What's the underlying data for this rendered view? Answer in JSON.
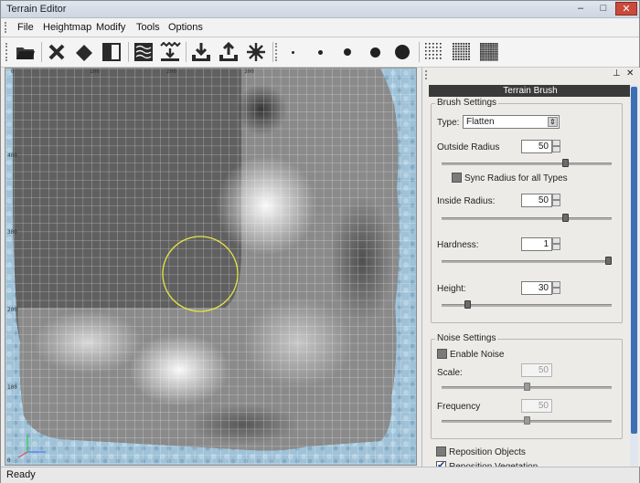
{
  "window": {
    "title": "Terrain Editor",
    "min": "–",
    "max": "□",
    "close": "✕"
  },
  "menu": [
    {
      "label": "File"
    },
    {
      "label": "Heightmap"
    },
    {
      "label": "Modify"
    },
    {
      "label": "Tools"
    },
    {
      "label": "Options"
    }
  ],
  "toolbar": {
    "icons": [
      "open-folder-icon",
      "clear-x-icon",
      "eraser-icon",
      "split-panel-icon",
      "terrain-texture-icon",
      "import-heightmap-icon",
      "download-icon",
      "export-icon",
      "sun-icon"
    ],
    "brush_sizes": [
      "tiny",
      "small",
      "medium",
      "large",
      "xlarge"
    ],
    "density": [
      "sparse",
      "medium",
      "dense"
    ]
  },
  "viewport": {
    "ruler_x": [
      "0",
      "100",
      "200",
      "300"
    ],
    "ruler_y": [
      "400",
      "300",
      "200",
      "100",
      "0"
    ],
    "colors": {
      "water": "#9bbcd3",
      "grid": "#ffffff"
    }
  },
  "panel": {
    "pin": "⊥",
    "close": "✕",
    "header": "Terrain Brush",
    "brush_settings": {
      "title": "Brush Settings",
      "type_label": "Type:",
      "type_value": "Flatten",
      "outside_radius_label": "Outside Radius",
      "outside_radius_value": "50",
      "outside_radius_pos": 0.74,
      "sync_label": "Sync Radius for all Types",
      "inside_radius_label": "Inside Radius:",
      "inside_radius_value": "50",
      "inside_radius_pos": 0.74,
      "hardness_label": "Hardness:",
      "hardness_value": "1",
      "hardness_pos": 1.0,
      "height_label": "Height:",
      "height_value": "30",
      "height_pos": 0.14
    },
    "noise_settings": {
      "title": "Noise Settings",
      "enable_label": "Enable Noise",
      "scale_label": "Scale:",
      "scale_value": "50",
      "scale_pos": 0.5,
      "frequency_label": "Frequency",
      "frequency_value": "50",
      "frequency_pos": 0.5
    },
    "reposition_objects_label": "Reposition Objects",
    "reposition_vegetation_label": "Reposition Vegetation",
    "reposition_vegetation_checked": true
  },
  "status": {
    "text": "Ready"
  }
}
